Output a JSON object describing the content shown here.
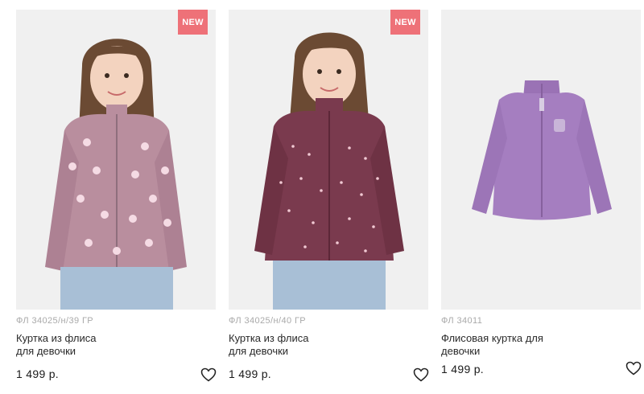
{
  "products": [
    {
      "badge": "NEW",
      "sku": "ФЛ 34025/н/39 ГР",
      "name_line1": "Куртка из флиса",
      "name_line2": "для девочки",
      "price": "1 499 р.",
      "image": "girl wearing pink fleece jacket with heart print",
      "icon": "heart-outline-icon"
    },
    {
      "badge": "NEW",
      "sku": "ФЛ 34025/н/40 ГР",
      "name_line1": "Куртка из флиса",
      "name_line2": "для девочки",
      "price": "1 499 р.",
      "image": "girl wearing burgundy fleece jacket with small hearts",
      "icon": "heart-outline-icon"
    },
    {
      "badge": "",
      "sku": "ФЛ 34011",
      "name_line1": "Флисовая куртка для",
      "name_line2": "девочки",
      "price": "1 499 р.",
      "image": "lilac fleece jacket product photo",
      "icon": "heart-outline-icon"
    }
  ],
  "colors": {
    "badge_bg": "#ee7178",
    "image_bg": "#f0f0f0",
    "sku_text": "#a9a9a9",
    "jacket_pink": "#b98e9e",
    "jacket_burgundy": "#7a3a4e",
    "jacket_lilac": "#a57ec0"
  }
}
